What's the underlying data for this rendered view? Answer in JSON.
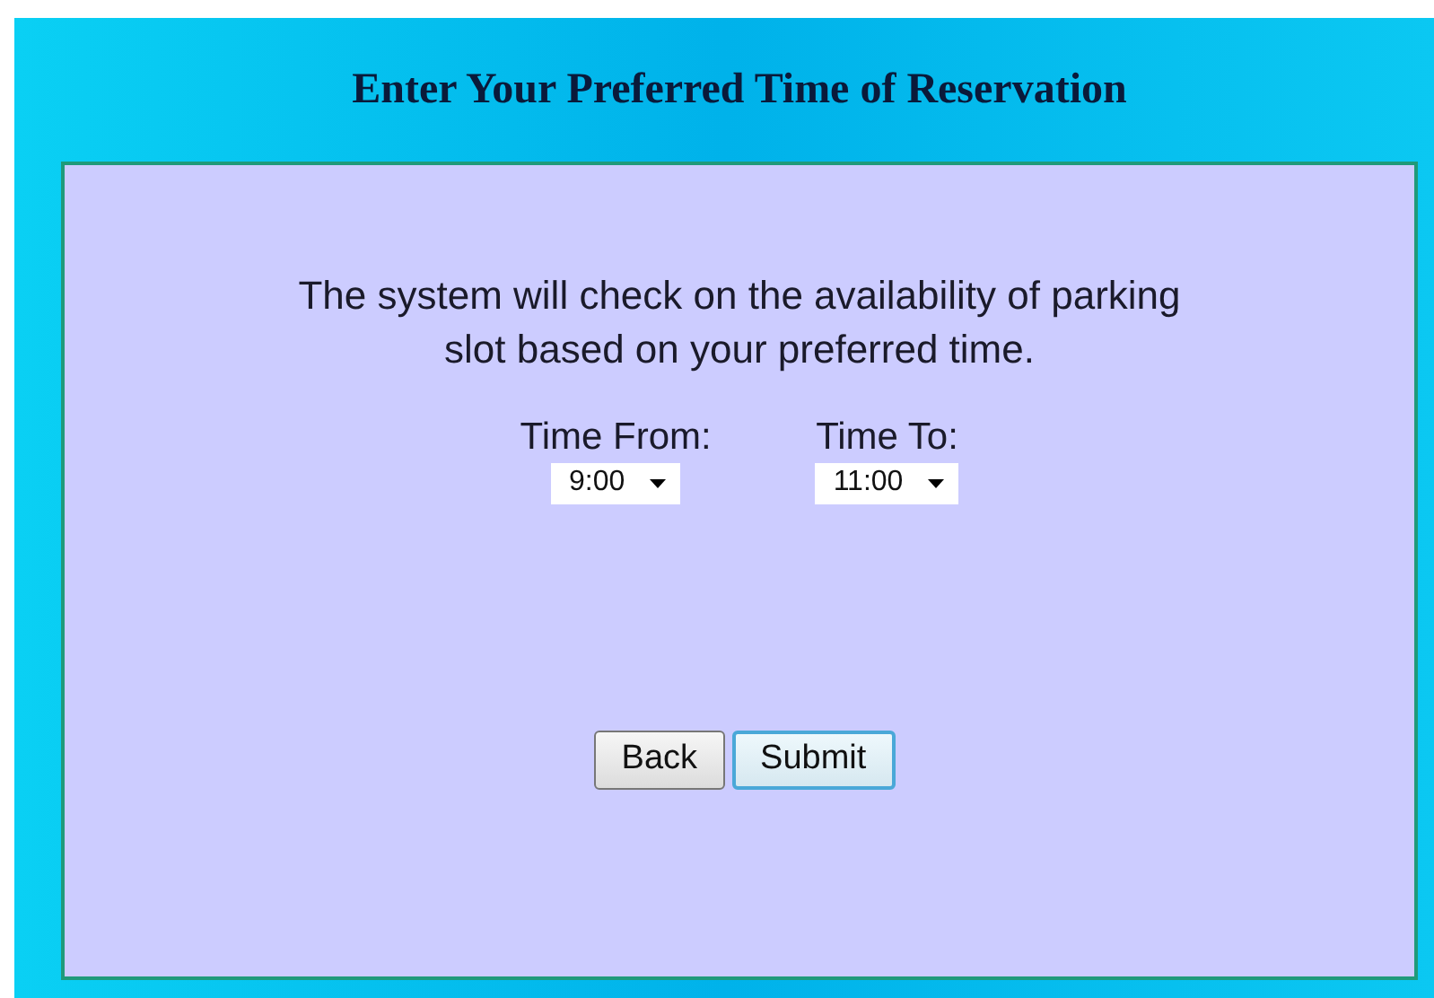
{
  "title": "Enter Your Preferred Time of Reservation",
  "message": "The system will check on the availability of parking slot based on your preferred time.",
  "fields": [
    {
      "label": "Time From:",
      "value": "9:00"
    },
    {
      "label": "Time To:",
      "value": "11:00"
    }
  ],
  "buttons": [
    {
      "label": "Back",
      "focused": false
    },
    {
      "label": "Submit",
      "focused": true
    }
  ]
}
